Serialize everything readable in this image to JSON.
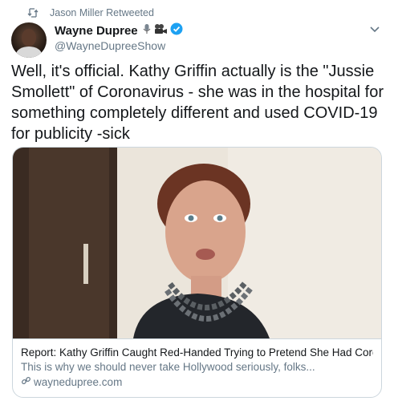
{
  "retweet": {
    "label": "Jason Miller Retweeted",
    "icon": "retweet-icon"
  },
  "author": {
    "name": "Wayne Dupree",
    "handle": "@WayneDupreeShow",
    "verified": true,
    "emojis": [
      "microphone-icon",
      "movie-camera-icon"
    ]
  },
  "tweet": {
    "text": "Well, it's official. Kathy Griffin actually is the \"Jussie Smollett\" of Coronavirus - she was in the hospital for something completely different and used COVID-19 for publicity -sick"
  },
  "card": {
    "title": "Report: Kathy Griffin Caught Red-Handed Trying to Pretend She Had Coronavirus",
    "description": "This is why we should never take Hollywood seriously, folks...",
    "domain": "waynedupree.com"
  },
  "colors": {
    "accent": "#1da1f2",
    "secondary_text": "#657786",
    "border": "#ccd6dd"
  }
}
